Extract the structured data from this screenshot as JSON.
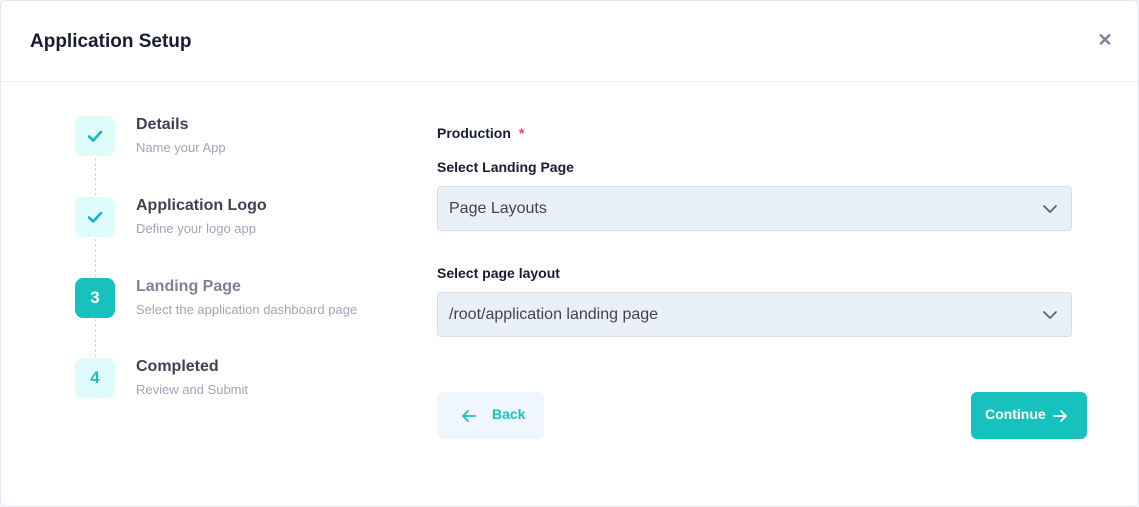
{
  "modal": {
    "title": "Application Setup",
    "close_icon": "close-icon"
  },
  "stepper": {
    "steps": [
      {
        "icon": "check",
        "title": "Details",
        "description": "Name your App",
        "state": "completed"
      },
      {
        "icon": "check",
        "title": "Application Logo",
        "description": "Define your logo app",
        "state": "completed"
      },
      {
        "number": "3",
        "title": "Landing Page",
        "description": "Select the application dashboard page",
        "state": "current"
      },
      {
        "number": "4",
        "title": "Completed",
        "description": "Review and Submit",
        "state": "pending"
      }
    ]
  },
  "form": {
    "section_label": "Production",
    "required_mark": "*",
    "landing_page": {
      "label": "Select Landing Page",
      "value": "Page Layouts"
    },
    "page_layout": {
      "label": "Select page layout",
      "value": "/root/application landing page"
    }
  },
  "actions": {
    "back_label": "Back",
    "continue_label": "Continue"
  },
  "colors": {
    "accent": "#17c1bd",
    "accent_light": "#e0fbfb",
    "required": "#f1416c",
    "select_bg": "#eaf0f8"
  }
}
